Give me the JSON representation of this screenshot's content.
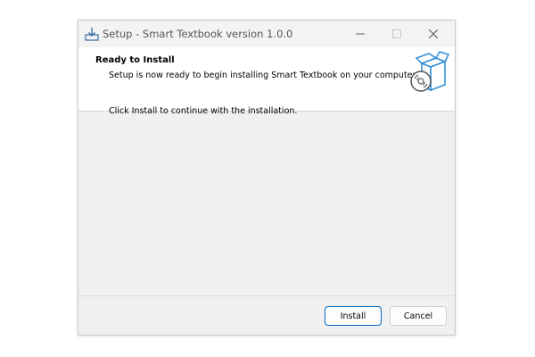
{
  "window": {
    "title": "Setup - Smart Textbook version 1.0.0",
    "controls": {
      "minimize_icon": "minimize-icon",
      "maximize_icon": "maximize-icon",
      "close_icon": "close-icon"
    }
  },
  "header": {
    "title": "Ready to Install",
    "subtitle": "Setup is now ready to begin installing Smart Textbook on your computer.",
    "art_icon": "software-box-disc-icon"
  },
  "body": {
    "message": "Click Install to continue with the installation."
  },
  "footer": {
    "install_label": "Install",
    "cancel_label": "Cancel"
  },
  "colors": {
    "accent": "#0067c0",
    "art_blue": "#2c8ed8",
    "dialog_background": "#f0f0f0"
  }
}
